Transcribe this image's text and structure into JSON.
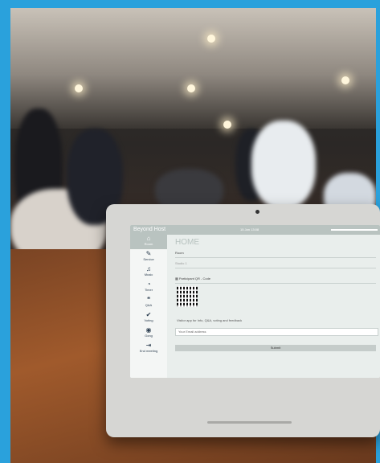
{
  "app": {
    "name": "Beyond Host",
    "date": "15 Jan 13:08"
  },
  "nav": [
    {
      "label": "Room",
      "icon": "home-icon"
    },
    {
      "label": "Service",
      "icon": "service-icon"
    },
    {
      "label": "Music",
      "icon": "music-icon"
    },
    {
      "label": "Timer",
      "icon": "timer-icon"
    },
    {
      "label": "Q&A",
      "icon": "qa-icon"
    },
    {
      "label": "Voting",
      "icon": "voting-icon"
    },
    {
      "label": "Gong",
      "icon": "gong-icon"
    },
    {
      "label": "End meeting",
      "icon": "exit-icon"
    }
  ],
  "main": {
    "title": "HOME",
    "room_label": "Room",
    "room_value": "Studio 1",
    "qr_title": "Participant QR - Code",
    "visitor_text": "Visitor app for Info, Q&A, voting and feedback",
    "email_placeholder": "Your Email address",
    "submit_label": "Submit"
  }
}
